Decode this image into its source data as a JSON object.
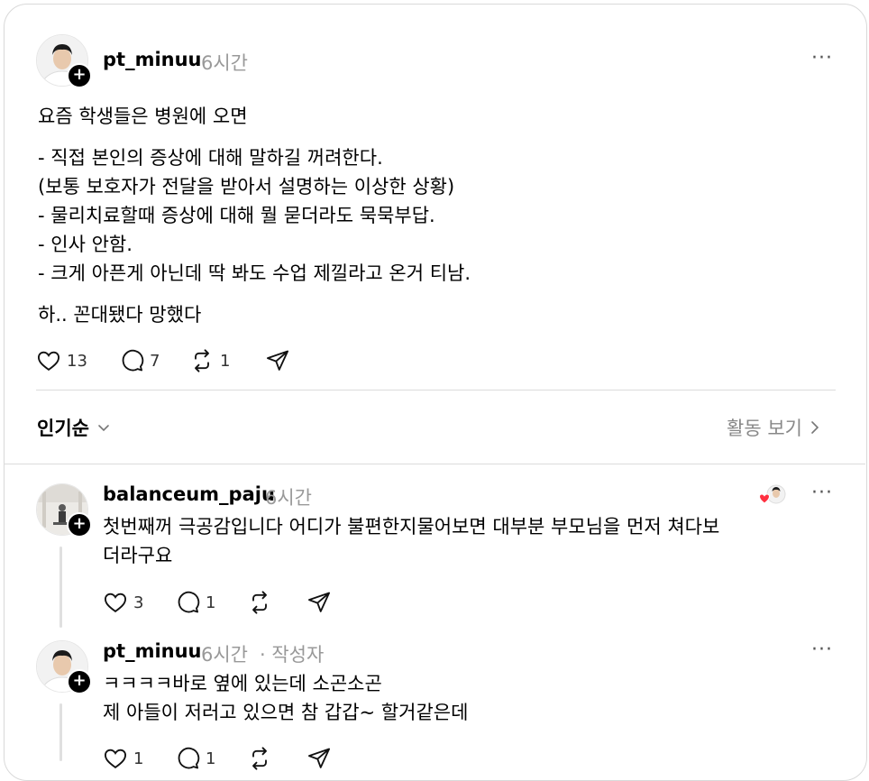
{
  "post": {
    "username": "pt_minuu",
    "time": "6시간",
    "more": "···",
    "title_line": "요즘 학생들은 병원에 오면",
    "body_lines": "- 직접 본인의 증상에 대해 말하길 꺼려한다.\n(보통 보호자가 전달을 받아서 설명하는 이상한 상황)\n- 물리치료할때 증상에 대해 뭘 묻더라도 묵묵부답.\n- 인사 안함.\n- 크게 아픈게 아닌데 딱 봐도 수업 제낄라고 온거 티남.",
    "closing_line": "하.. 꼰대됐다 망했다",
    "likes": "13",
    "comments": "7",
    "reposts": "1"
  },
  "sort": {
    "label": "인기순",
    "activity_label": "활동 보기"
  },
  "replies": [
    {
      "username": "balanceum_paju",
      "time": "6시간",
      "text": "첫번째꺼 극공감입니다 어디가 불편한지물어보면 대부분 부모님을 먼저 쳐다보\n더라구요",
      "likes": "3",
      "comments": "1",
      "more": "···"
    },
    {
      "username": "pt_minuu",
      "time": "6시간",
      "author_tag": "· 작성자",
      "text": "ㅋㅋㅋㅋ바로 옆에 있는데 소곤소곤\n제 아들이 저러고 있으면 참 갑갑~ 할거같은데",
      "likes": "1",
      "comments": "1",
      "more": "···"
    }
  ],
  "colors": {
    "accent_heart": "#ff3040",
    "muted": "#999999",
    "divider": "#dcdcdc"
  }
}
